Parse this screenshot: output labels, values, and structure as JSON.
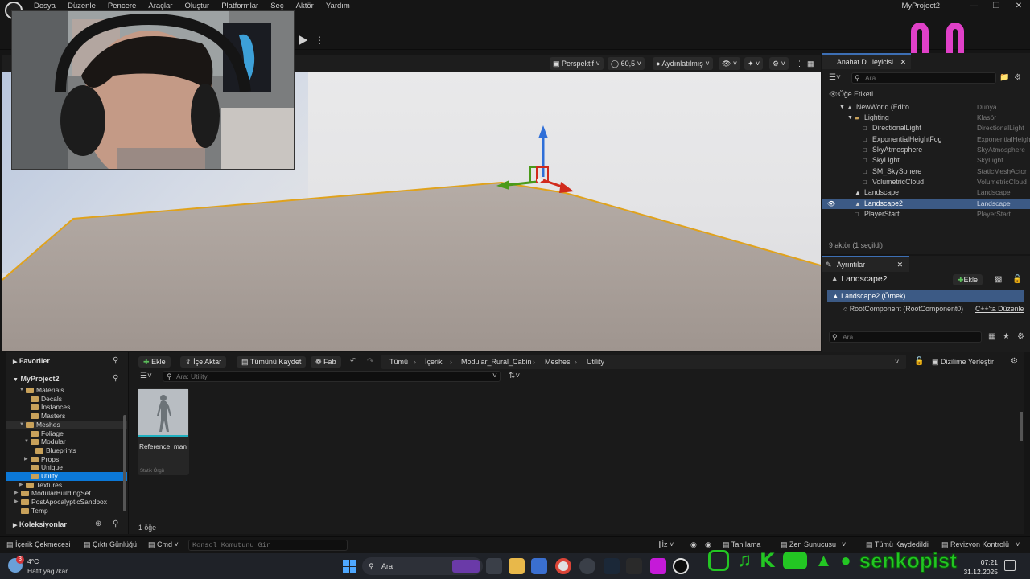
{
  "menu": [
    "Dosya",
    "Düzenle",
    "Pencere",
    "Araçlar",
    "Oluştur",
    "Platformlar",
    "Seç",
    "Aktör",
    "Yardım"
  ],
  "window_title": "MyProject2",
  "viewport": {
    "perspective_label": "Perspektif",
    "fov_value": "60,5",
    "lit_label": "Aydınlatılmış"
  },
  "outliner": {
    "tab_label": "Anahat D...leyicisi",
    "search_placeholder": "Ara...",
    "header_label": "Öğe Etiketi",
    "rows": [
      {
        "name": "NewWorld (Edito",
        "type": "Dünya",
        "indent": 2,
        "kind": "world"
      },
      {
        "name": "Lighting",
        "type": "Klasör",
        "indent": 3,
        "kind": "folder"
      },
      {
        "name": "DirectionalLight",
        "type": "DirectionalLight",
        "indent": 4,
        "kind": "actor"
      },
      {
        "name": "ExponentialHeightFog",
        "type": "ExponentialHeigh",
        "indent": 4,
        "kind": "actor"
      },
      {
        "name": "SkyAtmosphere",
        "type": "SkyAtmosphere",
        "indent": 4,
        "kind": "actor"
      },
      {
        "name": "SkyLight",
        "type": "SkyLight",
        "indent": 4,
        "kind": "actor"
      },
      {
        "name": "SM_SkySphere",
        "type": "StaticMeshActor",
        "indent": 4,
        "kind": "actor"
      },
      {
        "name": "VolumetricCloud",
        "type": "VolumetricCloud",
        "indent": 4,
        "kind": "actor"
      },
      {
        "name": "Landscape",
        "type": "Landscape",
        "indent": 3,
        "kind": "landscape"
      },
      {
        "name": "Landscape2",
        "type": "Landscape",
        "indent": 3,
        "kind": "landscape",
        "selected": true
      },
      {
        "name": "PlayerStart",
        "type": "PlayerStart",
        "indent": 3,
        "kind": "actor"
      }
    ],
    "footer": "9 aktör (1 seçildi)"
  },
  "details": {
    "tab_label": "Ayrıntılar",
    "actor_name": "Landscape2",
    "add_button": "Ekle",
    "instance_label": "Landscape2 (Örnek)",
    "root_component": "RootComponent (RootComponent0)",
    "cpp_edit": "C++'ta Düzenle",
    "search_placeholder": "Ara"
  },
  "content_browser": {
    "favorites_label": "Favoriler",
    "project_label": "MyProject2",
    "collections_label": "Koleksiyonlar",
    "buttons": {
      "add": "Ekle",
      "import": "İçe Aktar",
      "save_all": "Tümünü Kaydet",
      "fab": "Fab"
    },
    "breadcrumb": [
      "Tümü",
      "İçerik",
      "Modular_Rural_Cabin",
      "Meshes",
      "Utility"
    ],
    "dock_label": "Dizilime Yerleştir",
    "search_placeholder": "Ara: Utility",
    "item_count": "1 öğe",
    "tree": [
      {
        "label": "Materials",
        "indent": 3,
        "expanded": true
      },
      {
        "label": "Decals",
        "indent": 4
      },
      {
        "label": "Instances",
        "indent": 4
      },
      {
        "label": "Masters",
        "indent": 4
      },
      {
        "label": "Meshes",
        "indent": 3,
        "expanded": true,
        "hover": true
      },
      {
        "label": "Foliage",
        "indent": 4
      },
      {
        "label": "Modular",
        "indent": 4,
        "expanded": true
      },
      {
        "label": "Blueprints",
        "indent": 5
      },
      {
        "label": "Props",
        "indent": 4,
        "collapsed": true
      },
      {
        "label": "Unique",
        "indent": 4
      },
      {
        "label": "Utility",
        "indent": 4,
        "selected": true
      },
      {
        "label": "Textures",
        "indent": 3,
        "collapsed": true
      },
      {
        "label": "ModularBuildingSet",
        "indent": 2,
        "collapsed": true
      },
      {
        "label": "PostApocalypticSandbox",
        "indent": 2,
        "collapsed": true
      },
      {
        "label": "Temp",
        "indent": 2
      }
    ],
    "asset": {
      "name": "Reference_man",
      "type_label": "Statik Örgü"
    }
  },
  "statusbar": {
    "content_drawer": "İçerik Çekmecesi",
    "output_log": "Çıktı Günlüğü",
    "cmd": "Cmd",
    "console_placeholder": "Konsol Komutunu Gir",
    "trace": "İz",
    "derived_data": "Tanılama",
    "zen": "Zen Sunucusu",
    "all_saved": "Tümü Kaydedildi",
    "revision": "Revizyon Kontrolü"
  },
  "taskbar": {
    "weather_temp": "4°C",
    "weather_desc": "Hafif yağ./kar",
    "weather_badge": "3",
    "search_label": "Ara",
    "time": "07:21",
    "date": "31.12.2025"
  },
  "overlay": {
    "social_handle": "senkopist"
  },
  "colors": {
    "accent_blue": "#0b78d7",
    "selection": "#3c5a85",
    "landscape_edge": "#e0a21c",
    "gizmo_x": "#d12b1d",
    "gizmo_y": "#4a9a1a",
    "gizmo_z": "#2f6fd8",
    "smiley": "#e040c8",
    "social_green": "#23c623"
  }
}
